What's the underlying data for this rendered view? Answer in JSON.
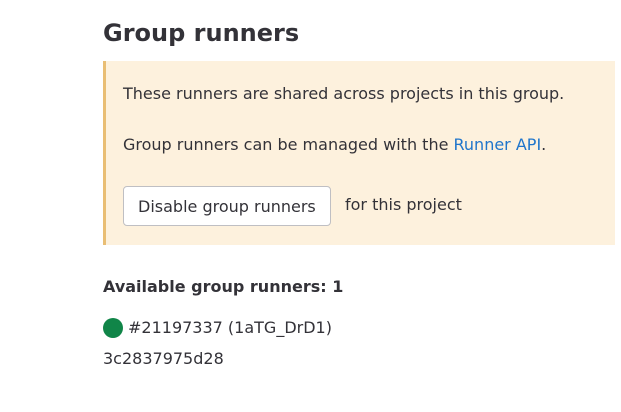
{
  "header": {
    "title": "Group runners"
  },
  "alert": {
    "line1": "These runners are shared across projects in this group.",
    "line2_prefix": "Group runners can be managed with the ",
    "line2_link": "Runner API",
    "line2_suffix": ".",
    "disable_button_label": "Disable group runners",
    "after_button_text": "for this project",
    "background_color": "#fdf1dd",
    "border_color": "#e9be74"
  },
  "runners": {
    "heading": "Available group runners: 1",
    "items": [
      {
        "status_icon": "online-status-dot-icon",
        "status_color": "#108548",
        "name": "#21197337 (1aTG_DrD1)",
        "description": "3c2837975d28"
      }
    ]
  }
}
